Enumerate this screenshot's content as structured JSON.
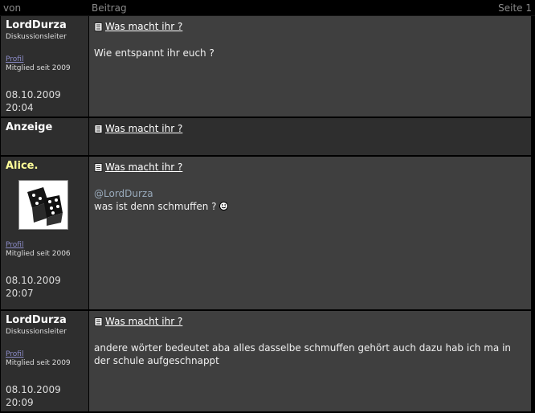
{
  "header": {
    "col_author": "von",
    "col_post": "Beitrag",
    "page": "Seite 1"
  },
  "posts": [
    {
      "author": "LordDurza",
      "rank": "Diskussionsleiter",
      "profile_link": "Profil",
      "member_since": "Mitglied seit 2009",
      "date": "08.10.2009",
      "time": "20:04",
      "subject": "Was macht ihr ?",
      "body": "Wie entspannt ihr euch ?"
    },
    {
      "author": "Anzeige",
      "subject": "Was macht ihr ?"
    },
    {
      "author": "Alice.",
      "profile_link": "Profil",
      "member_since": "Mitglied seit 2006",
      "date": "08.10.2009",
      "time": "20:07",
      "subject": "Was macht ihr ?",
      "mention": "@LordDurza",
      "body": "was ist denn schmuffen ?",
      "emoji_icon": "smiley-icon",
      "avatar_icon": "dice-avatar"
    },
    {
      "author": "LordDurza",
      "rank": "Diskussionsleiter",
      "profile_link": "Profil",
      "member_since": "Mitglied seit 2009",
      "date": "08.10.2009",
      "time": "20:09",
      "subject": "Was macht ihr ?",
      "body": "andere wörter bedeutet aba alles dasselbe schmuffen gehört auch dazu hab ich ma in der schule aufgeschnappt"
    }
  ],
  "colors": {
    "left_bg": "#2e2e2e",
    "right_bg": "#3f3f3f",
    "alice_name": "#ffff99",
    "link": "#8c8cc8"
  }
}
